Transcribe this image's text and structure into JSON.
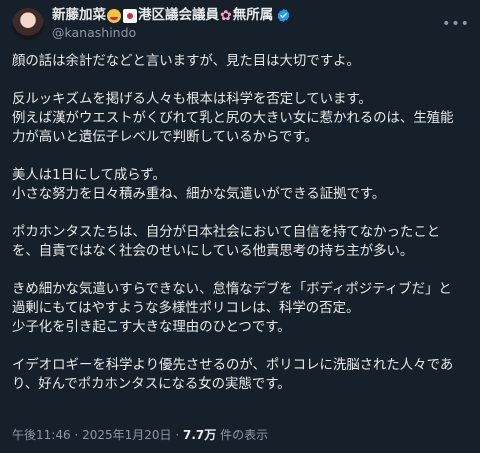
{
  "author": {
    "name": "新藤加菜",
    "name_suffix": "港区議会議員",
    "name_tail": "無所属",
    "handle": "@kanashindo",
    "emojis": [
      "face-emoji",
      "japan-flag-emoji",
      "cherry-blossom-emoji"
    ],
    "verified": true
  },
  "tweet": {
    "paragraphs": [
      [
        "顔の話は余計だなどと言いますが、見た目は大切ですよ。"
      ],
      [
        "反ルッキズムを掲げる人々も根本は科学を否定しています。",
        "例えば漢がウエストがくびれて乳と尻の大きい女に惹かれるのは、生殖能",
        "力が高いと遺伝子レベルで判断しているからです。"
      ],
      [
        "美人は1日にして成らず。",
        "小さな努力を日々積み重ね、細かな気遣いができる証拠です。"
      ],
      [
        "ポカホンタスたちは、自分が日本社会において自信を持てなかったこと",
        "を、自責ではなく社会のせいにしている他責思考の持ち主が多い。"
      ],
      [
        "きめ細かな気遣いすらできない、怠惰なデブを「ボディポジティブだ」と",
        "過剰にもてはやすような多様性ポリコレは、科学の否定。",
        "少子化を引き起こす大きな理由のひとつです。"
      ],
      [
        "イデオロギーを科学より優先させるのが、ポリコレに洗脳された人々であ",
        "り、好んでポカホンタスになる女の実態です。"
      ]
    ]
  },
  "meta": {
    "time": "午後11:46",
    "separator": "·",
    "date": "2025年1月20日",
    "views": "7.7万",
    "views_label": "件の表示"
  },
  "colors": {
    "background": "#15202b",
    "text": "#e7e9ea",
    "muted": "#8b98a5",
    "verified": "#1d9bf0"
  }
}
